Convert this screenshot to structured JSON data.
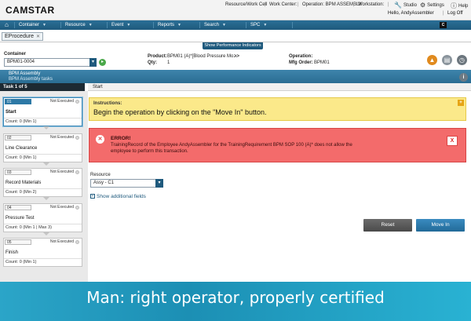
{
  "brand": {
    "logo": "CAMSTAR"
  },
  "header": {
    "resource_label": "Resource/Work Cell",
    "work_center_label": "Work Center:",
    "operation_label": "Operation: BPM ASSEMBLY",
    "workstation_label": "Workstation:",
    "studio": "Studio",
    "settings": "Settings",
    "help": "Help",
    "greeting": "Hello, AndyAssembler",
    "logoff": "Log Off"
  },
  "nav": {
    "items": [
      {
        "label": "Container"
      },
      {
        "label": "Resource"
      },
      {
        "label": "Event"
      },
      {
        "label": "Reports"
      },
      {
        "label": "Search"
      },
      {
        "label": "SPC"
      }
    ],
    "badge": "C"
  },
  "tab": {
    "label": "EProcedure",
    "close": "✕"
  },
  "perf_toggle": "Show Performance Indicators",
  "info": {
    "container_label": "Container",
    "container_value": "BPM01-0004",
    "product_label": "Product:",
    "product_value": "BPM01 (A)*[Blood Pressure Mo...",
    "qty_label": "Qty:",
    "qty_value": "1",
    "operation_label": "Operation:",
    "operation_value": "",
    "mfg_order_label": "Mfg Order:",
    "mfg_order_value": "BPM01"
  },
  "section": {
    "title": "BPM Assembly",
    "subtitle": "BPM Assembly tasks"
  },
  "task_header": "Task 1 of 5",
  "breadcrumb": "Start",
  "tasks": [
    {
      "num": "01",
      "status": "Not Executed",
      "name": "Start",
      "count": "Count: 0 (Min 1)"
    },
    {
      "num": "02",
      "status": "Not Executed",
      "name": "Line Clearance",
      "count": "Count: 0 (Min 1)"
    },
    {
      "num": "03",
      "status": "Not Executed",
      "name": "Record Materials",
      "count": "Count: 0 (Min 2)"
    },
    {
      "num": "04",
      "status": "Not Executed",
      "name": "Pressure Test",
      "count": "Count: 0 (Min 1 | Max 3)"
    },
    {
      "num": "05",
      "status": "Not Executed",
      "name": "Finish",
      "count": "Count: 0 (Min 1)"
    }
  ],
  "instructions": {
    "heading": "Instructions:",
    "body": "Begin the operation by clicking on the \"Move In\" button."
  },
  "error": {
    "heading": "ERROR!",
    "message": "TrainingRecord of the Employee AndyAssembler for the TrainingRequirement BPM SOP 100 (A)* does not allow the employee to perform this transaction.",
    "close": "X"
  },
  "resource": {
    "label": "Resource",
    "value": "Assy - C1"
  },
  "show_additional": "Show additional fields",
  "buttons": {
    "reset": "Reset",
    "move_in": "Move In"
  },
  "caption": "Man: right operator, properly certified",
  "colors": {
    "nav": "#1f5a7d",
    "error": "#f36b6b",
    "instructions": "#fbe98a",
    "caption": "#1c8fb4"
  }
}
